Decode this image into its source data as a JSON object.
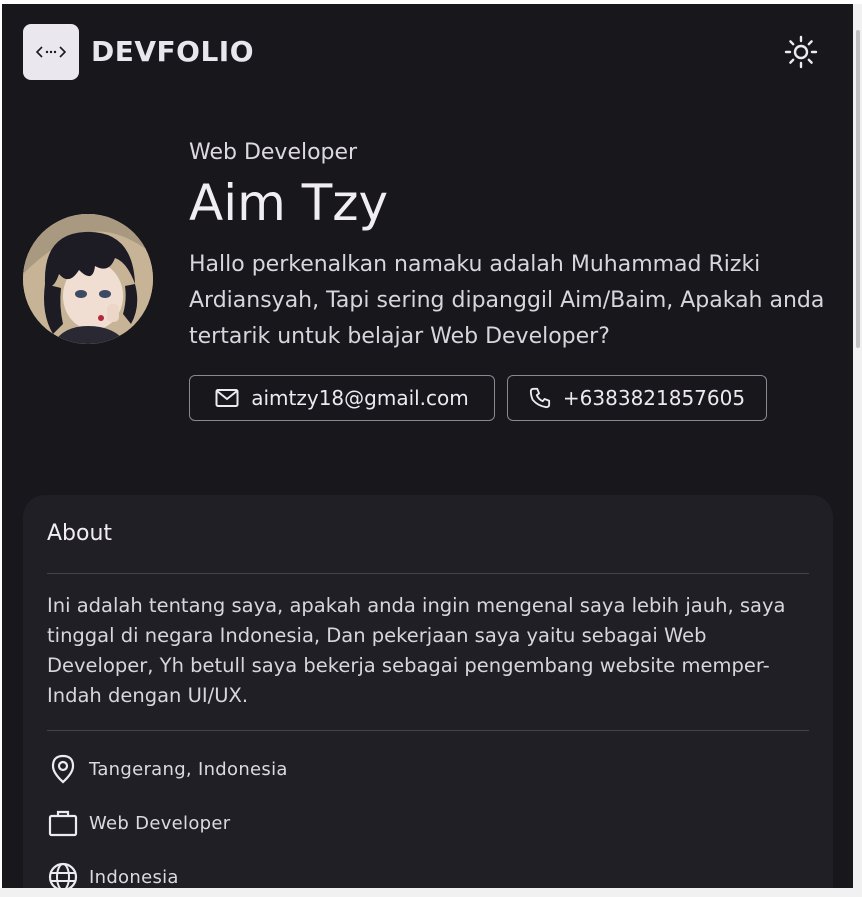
{
  "header": {
    "logo_icon": "code-brackets-icon",
    "logo_text": "DEVFOLIO",
    "theme_icon": "sun-icon"
  },
  "hero": {
    "role": "Web Developer",
    "name": "Aim Tzy",
    "intro": "Hallo perkenalkan namaku adalah Muhammad Rizki Ardiansyah, Tapi sering dipanggil Aim/Baim, Apakah anda tertarik untuk belajar Web Developer?",
    "email": "aimtzy18@gmail.com",
    "phone": "+6383821857605"
  },
  "about": {
    "title": "About",
    "text": "Ini adalah tentang saya, apakah anda ingin mengenal saya lebih jauh, saya tinggal di negara Indonesia, Dan pekerjaan saya yaitu sebagai Web Developer, Yh betull saya bekerja sebagai pengembang website memper-Indah dengan UI/UX.",
    "items": [
      {
        "icon": "map-pin-icon",
        "label": "Tangerang, Indonesia"
      },
      {
        "icon": "briefcase-icon",
        "label": "Web Developer"
      },
      {
        "icon": "globe-icon",
        "label": "Indonesia"
      }
    ]
  },
  "colors": {
    "background": "#18171c",
    "card": "#211f26",
    "text": "#f0eef3",
    "logo_bg": "#eae8ee"
  }
}
